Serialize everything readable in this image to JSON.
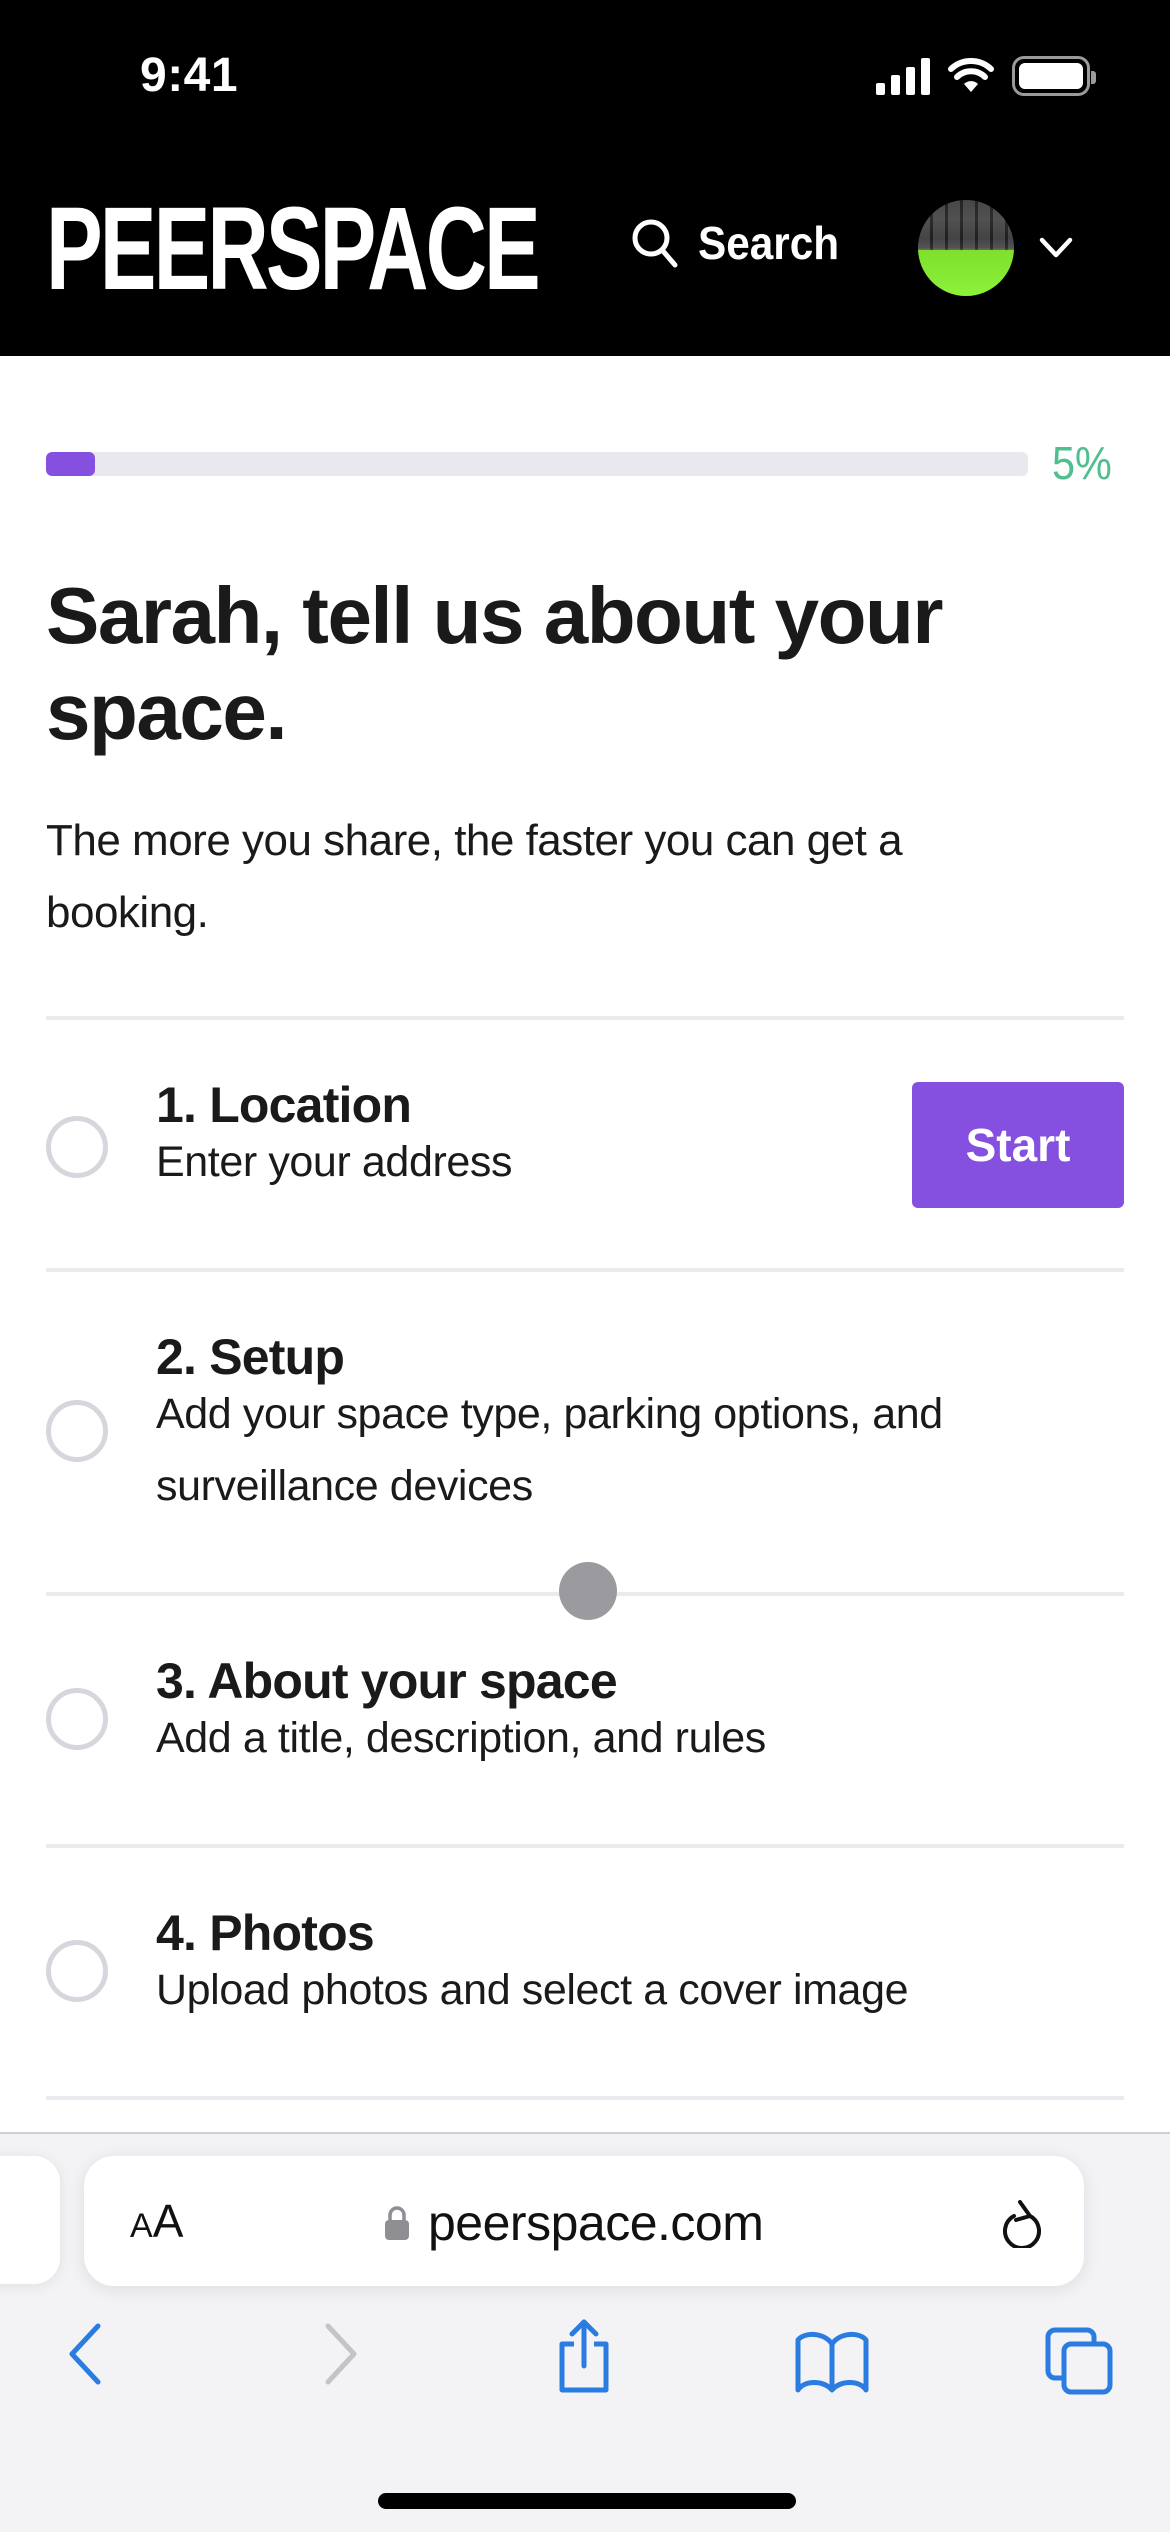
{
  "status_bar": {
    "time": "9:41"
  },
  "header": {
    "logo": "PEERSPACE",
    "search_label": "Search",
    "avatar_alt": "User avatar"
  },
  "progress": {
    "percent": 5,
    "label": "5%",
    "fill_color": "#8550e0",
    "label_color": "#4fbf8e"
  },
  "intro": {
    "headline": "Sarah, tell us about your space.",
    "subheadline": "The more you share, the faster you can get a booking."
  },
  "steps": [
    {
      "title": "1. Location",
      "description": "Enter your address",
      "action_label": "Start",
      "completed": false
    },
    {
      "title": "2. Setup",
      "description": "Add your space type, parking options, and surveillance devices",
      "completed": false
    },
    {
      "title": "3. About your space",
      "description": "Add a title, description, and rules",
      "completed": false
    },
    {
      "title": "4. Photos",
      "description": "Upload photos and select a cover image",
      "completed": false
    }
  ],
  "browser": {
    "text_size_label_small": "A",
    "text_size_label_large": "A",
    "url": "peerspace.com",
    "accent_color": "#2a7ce0",
    "toolbar": [
      "back-icon",
      "forward-icon",
      "share-icon",
      "bookmarks-icon",
      "tabs-icon"
    ]
  }
}
